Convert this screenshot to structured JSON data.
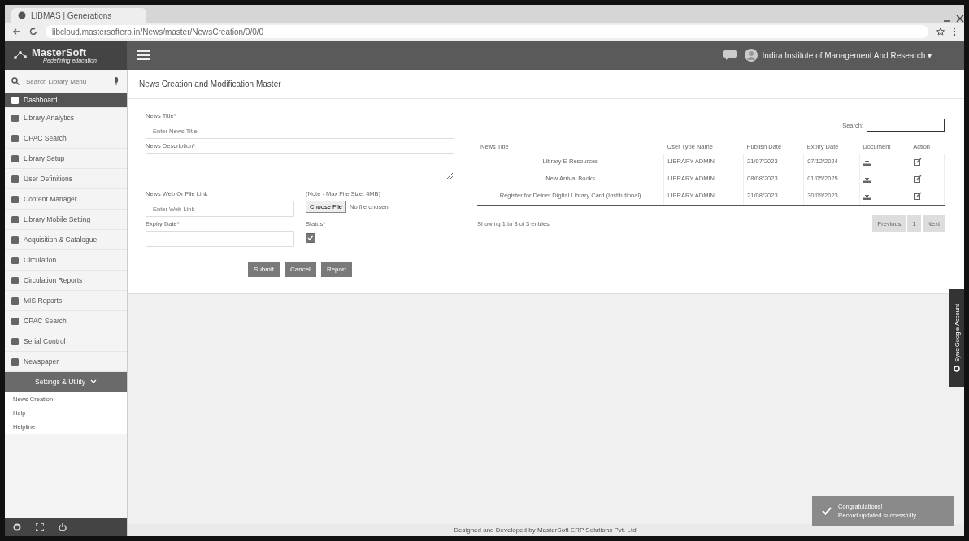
{
  "browser": {
    "tab_title": "LIBMAS | Generations",
    "url": "libcloud.mastersofterp.in/News/master/NewsCreation/0/0/0"
  },
  "header": {
    "logo": "MasterSoft",
    "tagline": "Redefining education",
    "user": "Indira Institute of Management And Research ▾"
  },
  "sidebar": {
    "search_placeholder": "Search Library Menu",
    "items": [
      {
        "label": "Dashboard",
        "selected": true,
        "expanded": false
      },
      {
        "label": "Library Analytics",
        "selected": false,
        "expanded": false
      },
      {
        "label": "OPAC Search",
        "selected": false,
        "expanded": false
      },
      {
        "label": "Library Setup",
        "selected": false,
        "expanded": false
      },
      {
        "label": "User Definitions",
        "selected": false,
        "expanded": false
      },
      {
        "label": "Content Manager",
        "selected": false,
        "expanded": false
      },
      {
        "label": "Library Mobile Setting",
        "selected": false,
        "expanded": false
      },
      {
        "label": "Acquisition & Catalogue",
        "selected": false,
        "expanded": false
      },
      {
        "label": "Circulation",
        "selected": false,
        "expanded": false
      },
      {
        "label": "Circulation Reports",
        "selected": false,
        "expanded": false
      },
      {
        "label": "MIS Reports",
        "selected": false,
        "expanded": false
      },
      {
        "label": "OPAC Search",
        "selected": false,
        "expanded": false
      },
      {
        "label": "Serial Control",
        "selected": false,
        "expanded": false
      },
      {
        "label": "Newspaper",
        "selected": false,
        "expanded": false
      },
      {
        "label": "Settings & Utility",
        "selected": false,
        "expanded": true,
        "children": [
          {
            "label": "News Creation"
          },
          {
            "label": "Help"
          },
          {
            "label": "Helpline"
          }
        ]
      }
    ]
  },
  "breadcrumb": "News Creation and Modification Master",
  "form": {
    "title_label": "News Title*",
    "title_placeholder": "Enter News Title",
    "description_label": "News Description*",
    "link_label": "News Web Or File Link",
    "link_placeholder": "Enter Web Link",
    "file_note": "(Note - Max File Size: 4MB)",
    "file_button": "Choose File",
    "file_status": "No file chosen",
    "expiry_label": "Expiry Date*",
    "status_label": "Status*",
    "status_checked": true,
    "buttons": [
      "Submit",
      "Cancel",
      "Report"
    ]
  },
  "table": {
    "search_label": "Search:",
    "columns": [
      "News Title",
      "User Type Name",
      "Publish Date",
      "Expiry Date",
      "Document",
      "Action"
    ],
    "rows": [
      {
        "title": "Library E-Resources",
        "user_type": "LIBRARY ADMIN",
        "publish": "21/07/2023",
        "expiry": "07/12/2024"
      },
      {
        "title": "New Arrival Books",
        "user_type": "LIBRARY ADMIN",
        "publish": "08/08/2023",
        "expiry": "01/05/2025"
      },
      {
        "title": "Register for Delnet Digital Library Card (Institutional)",
        "user_type": "LIBRARY ADMIN",
        "publish": "21/08/2023",
        "expiry": "30/09/2023"
      }
    ],
    "info": "Showing 1 to 3 of 3 entries",
    "pages": [
      "Previous",
      "1",
      "Next"
    ]
  },
  "side_tab": "Sync Google Account",
  "footer": "Designed and Developed by MasterSoft ERP Solutions Pvt. Ltd.",
  "toast": {
    "title": "Congratulations!",
    "message": "Record updated successfully"
  }
}
